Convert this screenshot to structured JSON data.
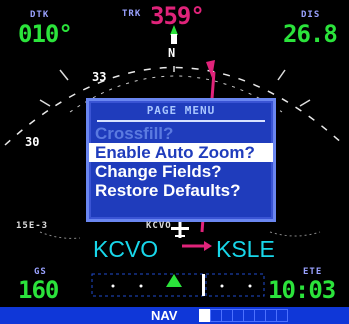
{
  "top": {
    "dtk_label": "DTK",
    "dtk_value": "010°",
    "trk_label": "TRK",
    "trk_value": "359°",
    "dis_label": "DIS",
    "dis_value": "26.8"
  },
  "compass": {
    "n": "N",
    "mark_33": "33",
    "mark_30": "30"
  },
  "menu": {
    "title": "PAGE MENU",
    "items": [
      "Crossfill?",
      "Enable Auto Zoom?",
      "Change Fields?",
      "Restore Defaults?"
    ]
  },
  "map": {
    "left_range": "15E-3",
    "tag_kcvo": "KCVO",
    "from_waypoint": "KCVO",
    "to_waypoint": "KSLE"
  },
  "bottom": {
    "gs_label": "GS",
    "gs_value": "160",
    "ete_label": "ETE",
    "ete_value": "10:03"
  },
  "status": {
    "nav_label": "NAV",
    "page_count": 8,
    "page_index": 0
  },
  "colors": {
    "cyan": "#18d7ea",
    "green": "#2be33b",
    "magenta": "#e0237a",
    "menu_blue": "#1f3cbc"
  }
}
